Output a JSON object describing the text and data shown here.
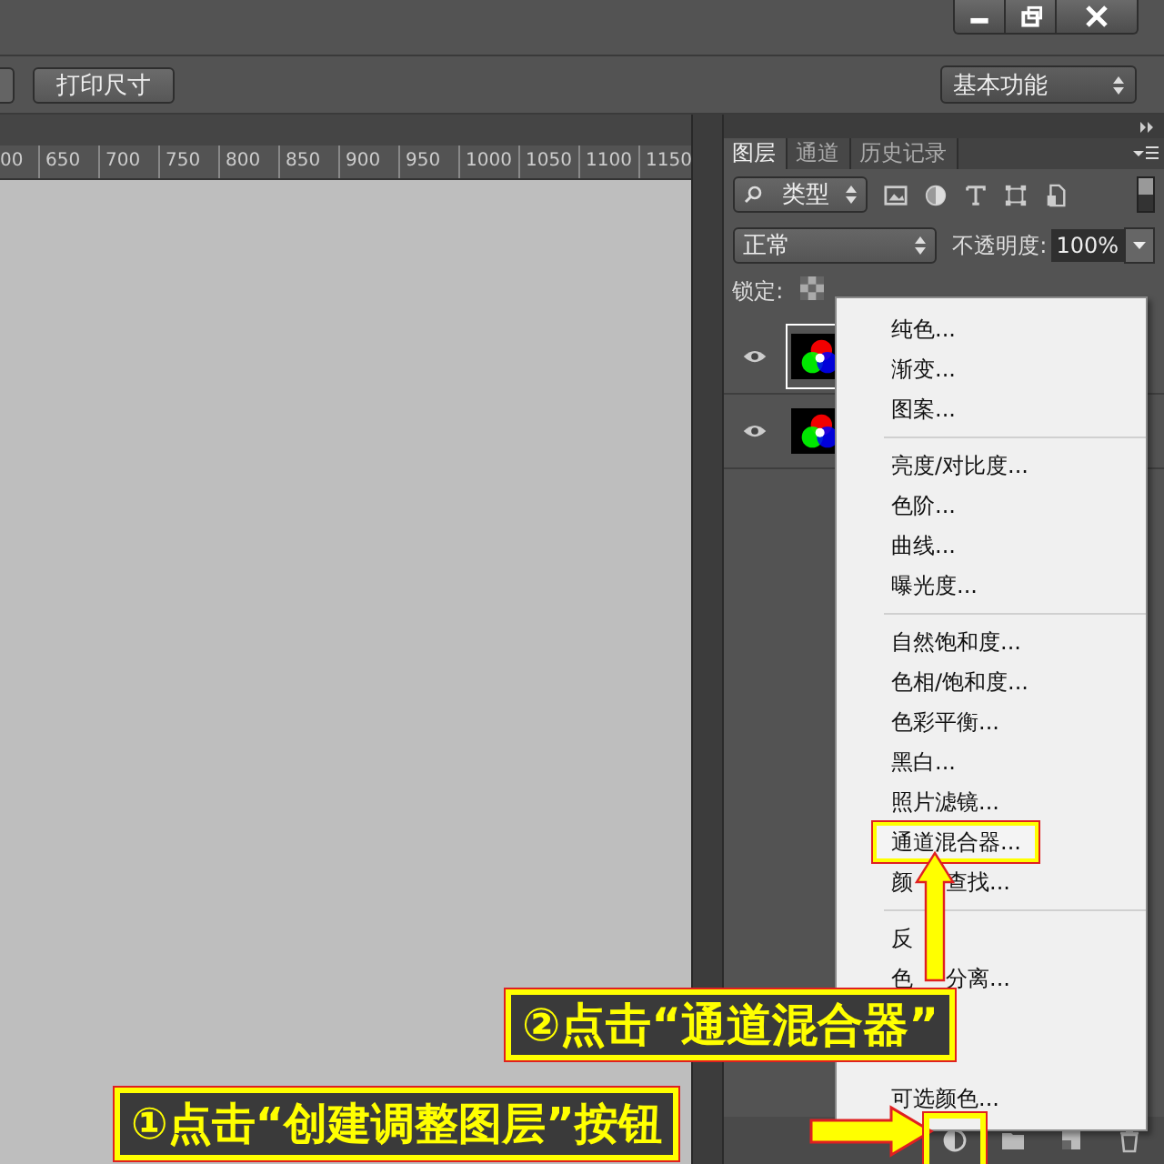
{
  "options_bar": {
    "buttons": [
      "打印尺寸"
    ],
    "workspace": "基本功能"
  },
  "ruler": [
    "00",
    "650",
    "700",
    "750",
    "800",
    "850",
    "900",
    "950",
    "1000",
    "1050",
    "1100",
    "1150"
  ],
  "layers_panel": {
    "tabs": [
      {
        "label": "图层",
        "selected": true
      },
      {
        "label": "通道",
        "selected": false
      },
      {
        "label": "历史记录",
        "selected": false
      }
    ],
    "filter": "类型",
    "blend_mode": "正常",
    "opacity_label": "不透明度:",
    "opacity": "100%",
    "lock_label": "锁定:",
    "layers": [
      {
        "selected": true
      },
      {
        "selected": false
      }
    ]
  },
  "adjustment_menu": [
    [
      {
        "label": "纯色...",
        "highlighted": false
      },
      {
        "label": "渐变...",
        "highlighted": false
      },
      {
        "label": "图案...",
        "highlighted": false
      }
    ],
    [
      {
        "label": "亮度/对比度...",
        "highlighted": false
      },
      {
        "label": "色阶...",
        "highlighted": false
      },
      {
        "label": "曲线...",
        "highlighted": false
      },
      {
        "label": "曝光度...",
        "highlighted": false
      }
    ],
    [
      {
        "label": "自然饱和度...",
        "highlighted": false
      },
      {
        "label": "色相/饱和度...",
        "highlighted": false
      },
      {
        "label": "色彩平衡...",
        "highlighted": false
      },
      {
        "label": "黑白...",
        "highlighted": false
      },
      {
        "label": "照片滤镜...",
        "highlighted": false
      },
      {
        "label": "通道混合器...",
        "highlighted": true
      },
      {
        "parts": [
          "颜",
          "查找..."
        ],
        "highlighted": false
      }
    ],
    [
      {
        "parts": [
          "反"
        ],
        "highlighted": false
      },
      {
        "parts": [
          "色",
          "分离..."
        ],
        "highlighted": false
      },
      {
        "label": "可选颜色...",
        "highlighted": false
      }
    ]
  ],
  "callouts": [
    {
      "text": "②点击“通道混合器”"
    },
    {
      "text": "①点击“创建调整图层”按钮"
    }
  ]
}
